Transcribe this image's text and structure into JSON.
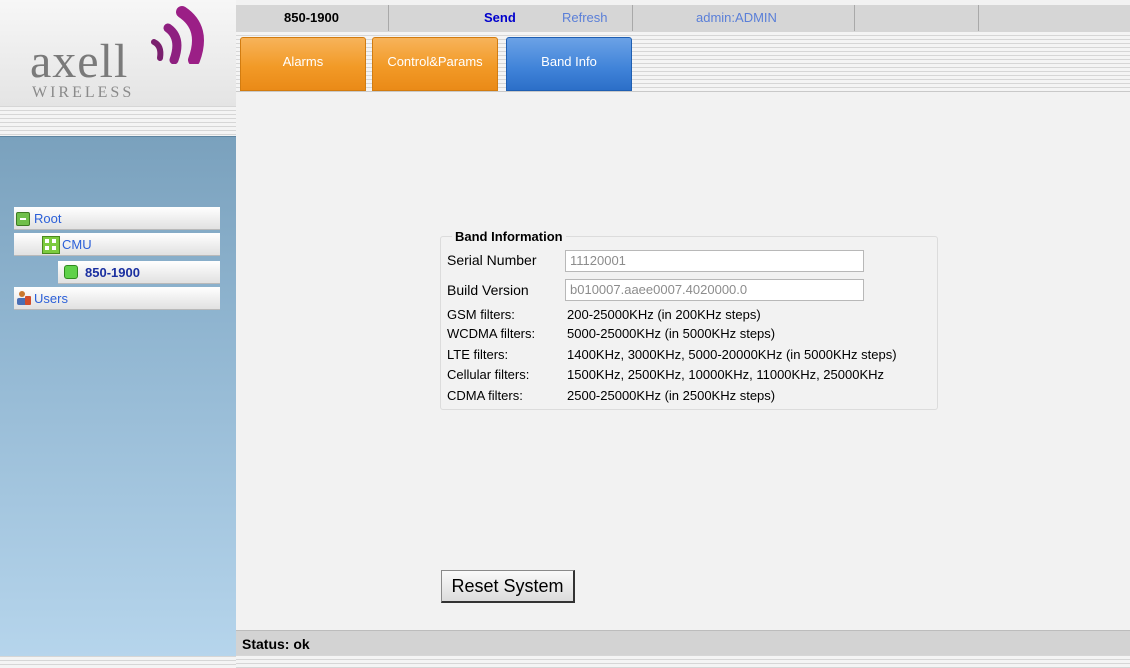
{
  "logo": {
    "brand": "axell",
    "sub": "WIRELESS"
  },
  "topbar": {
    "device": "850-1900",
    "send_label": "Send",
    "refresh_label": "Refresh",
    "user": "admin:ADMIN"
  },
  "tabs": [
    {
      "label": "Alarms",
      "active": false
    },
    {
      "label": "Control&Params",
      "active": false
    },
    {
      "label": "Band Info",
      "active": true
    }
  ],
  "tree": {
    "root": "Root",
    "cmu": "CMU",
    "device": "850-1900",
    "users": "Users"
  },
  "band_info": {
    "legend": "Band Information",
    "serial_label": "Serial Number",
    "serial_value": "11120001",
    "build_label": "Build Version",
    "build_value": "b010007.aaee0007.4020000.0",
    "rows": [
      {
        "label": "GSM filters:",
        "value": "200-25000KHz (in 200KHz steps)"
      },
      {
        "label": "WCDMA filters:",
        "value": "5000-25000KHz (in 5000KHz steps)"
      },
      {
        "label": "LTE filters:",
        "value": "1400KHz, 3000KHz, 5000-20000KHz (in 5000KHz steps)"
      },
      {
        "label": "Cellular filters:",
        "value": "1500KHz, 2500KHz, 10000KHz, 11000KHz, 25000KHz"
      },
      {
        "label": "CDMA filters:",
        "value": "2500-25000KHz (in 2500KHz steps)"
      }
    ]
  },
  "reset_label": "Reset System",
  "status": "Status: ok",
  "colors": {
    "tab_orange": "#f29a27",
    "tab_blue": "#3f82d8",
    "link_blue": "#2b5fd8",
    "send_blue": "#0000cc"
  }
}
